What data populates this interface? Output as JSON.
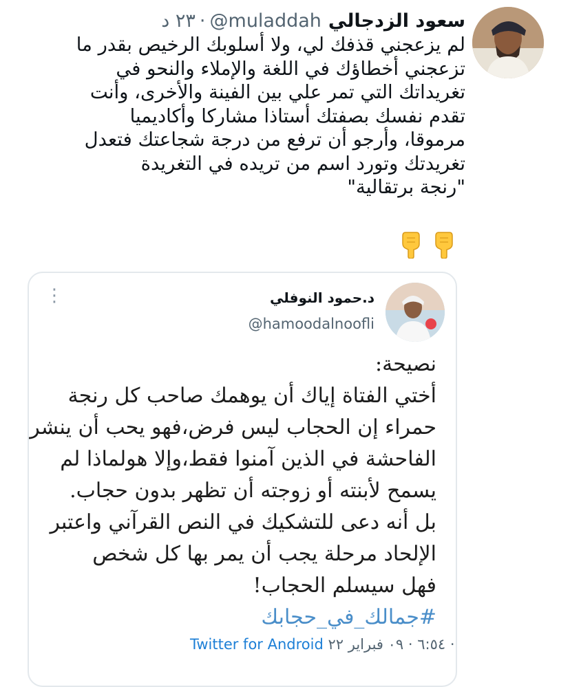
{
  "tweet": {
    "author_name": "سعود الزدجالي",
    "handle": "@muladdah",
    "time": "٢٣ د",
    "text_lines": [
      "لم يزعجني قذفك لي، ولا أسلوبك الرخيص بقدر ما",
      "تزعجني أخطاؤك في اللغة والإملاء والنحو في",
      "تغريداتك التي تمر علي بين الفينة والأخرى، وأنت",
      "تقدم نفسك بصفتك أستاذا مشاركا وأكاديميا",
      "مرموقا، وأرجو أن ترفع من درجة شجاعتك فتعدل",
      "تغريدتك وتورد اسم من تريده في التغريدة",
      "\"رنجة برتقالية\""
    ],
    "emoji": [
      "pointing-down-hand-icon",
      "pointing-down-hand-icon"
    ]
  },
  "quoted": {
    "author_name": "د.حمود النوفلي",
    "handle": "@hamoodalnoofli",
    "text_lines": [
      "نصيحة:",
      "أختي الفتاة إياك أن يوهمك صاحب كل رنجة",
      "حمراء إن الحجاب ليس فرض،فهو يحب أن ينشر",
      "الفاحشة في الذين آمنوا فقط،وإلا هولماذا لم",
      "يسمح لأبنته أو زوجته أن تظهر بدون حجاب.",
      "بل أنه دعى للتشكيك في النص القرآني واعتبر",
      "الإلحاد مرحلة يجب أن يمر بها كل شخص",
      "فهل سيسلم الحجاب!"
    ],
    "hashtag": "#جمالك_في_حجابك",
    "timestamp": "٦:٥٤ · ٠٩ فبراير ٢٢ ·",
    "source": "Twitter for Android"
  },
  "colors": {
    "text": "#0f1419",
    "secondary": "#536471",
    "link": "#1d7fd6",
    "border": "#e3e8ec"
  }
}
